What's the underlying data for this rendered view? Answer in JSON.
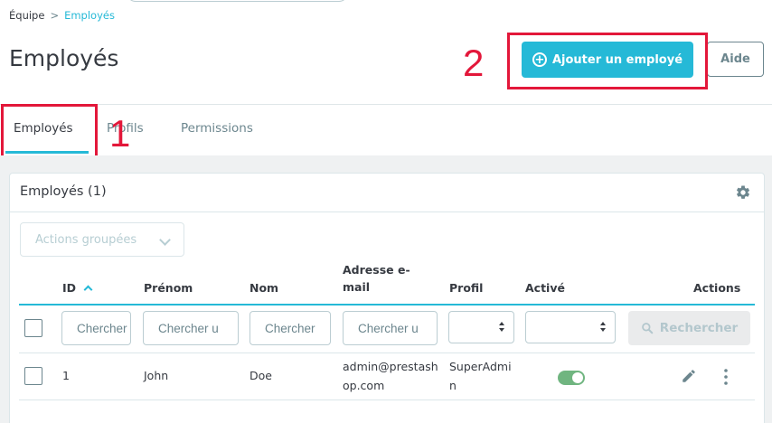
{
  "breadcrumb": {
    "parent": "Équipe",
    "separator": ">",
    "current": "Employés"
  },
  "page_title": "Employés",
  "header_buttons": {
    "add_employee": "Ajouter un employé",
    "help": "Aide"
  },
  "annotations": {
    "first": "1",
    "second": "2"
  },
  "tabs": [
    {
      "label": "Employés",
      "active": true
    },
    {
      "label": "Profils",
      "active": false
    },
    {
      "label": "Permissions",
      "active": false
    }
  ],
  "card": {
    "title": "Employés (1)",
    "bulk_actions": "Actions groupées"
  },
  "table": {
    "columns": {
      "id": "ID",
      "firstname": "Prénom",
      "lastname": "Nom",
      "email_line1": "Adresse e-",
      "email_line2": "mail",
      "profile": "Profil",
      "active": "Activé",
      "actions": "Actions"
    },
    "filter_placeholders": {
      "id": "Chercher",
      "firstname": "Chercher u",
      "lastname": "Chercher",
      "email": "Chercher u"
    },
    "search_button": "Rechercher",
    "rows": [
      {
        "id": "1",
        "firstname": "John",
        "lastname": "Doe",
        "email_line1": "admin@prestash",
        "email_line2": "op.com",
        "profile_line1": "SuperAdmi",
        "profile_line2": "n",
        "active": true
      }
    ]
  },
  "colors": {
    "accent": "#25b9d7",
    "annotation": "#e3173a",
    "toggle_on": "#70b580"
  }
}
